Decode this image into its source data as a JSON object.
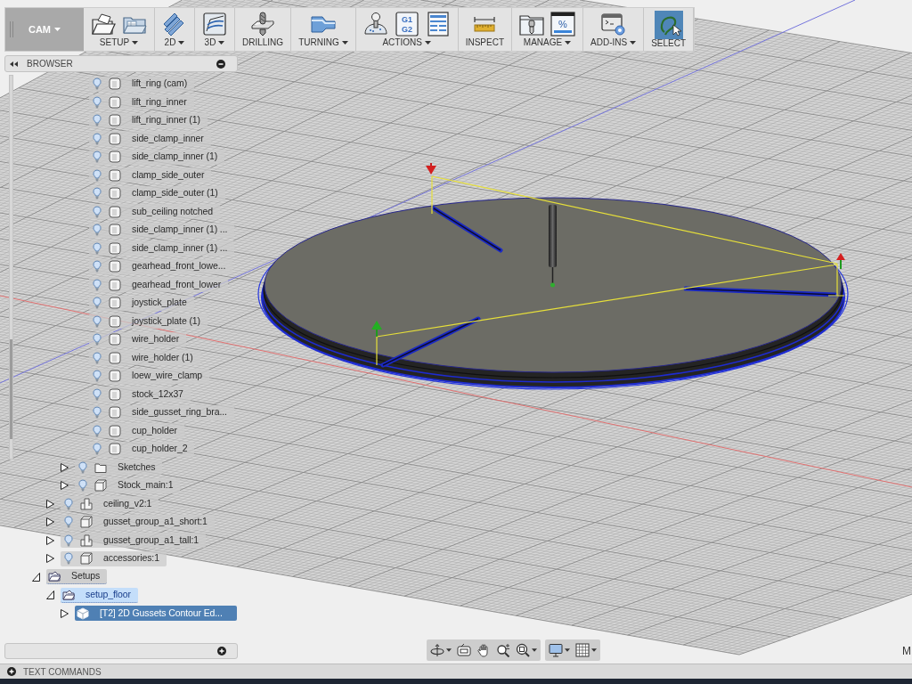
{
  "toolbar": {
    "workspace": {
      "label": "CAM",
      "dropdown": true
    },
    "groups": [
      {
        "label": "SETUP",
        "dropdown": true,
        "selected": false,
        "icons": [
          {
            "kind": "new_setup"
          },
          {
            "kind": "folder"
          }
        ]
      },
      {
        "label": "2D",
        "dropdown": true,
        "selected": false,
        "icons": [
          {
            "kind": "layers"
          }
        ]
      },
      {
        "label": "3D",
        "dropdown": true,
        "selected": false,
        "icons": [
          {
            "kind": "surface"
          }
        ]
      },
      {
        "label": "DRILLING",
        "dropdown": false,
        "selected": false,
        "icons": [
          {
            "kind": "drill"
          }
        ]
      },
      {
        "label": "TURNING",
        "dropdown": true,
        "selected": false,
        "icons": [
          {
            "kind": "lathe"
          }
        ]
      },
      {
        "label": "ACTIONS",
        "dropdown": true,
        "selected": false,
        "icons": [
          {
            "kind": "joystick"
          },
          {
            "kind": "code",
            "text": [
              "G1",
              "G2"
            ]
          },
          {
            "kind": "sheet"
          }
        ]
      },
      {
        "label": "INSPECT",
        "dropdown": false,
        "selected": false,
        "icons": [
          {
            "kind": "ruler"
          }
        ]
      },
      {
        "label": "MANAGE",
        "dropdown": true,
        "selected": false,
        "icons": [
          {
            "kind": "tool_folder"
          },
          {
            "kind": "window",
            "text": [
              "%"
            ]
          }
        ]
      },
      {
        "label": "ADD-INS",
        "dropdown": true,
        "selected": false,
        "icons": [
          {
            "kind": "terminal"
          }
        ]
      },
      {
        "label": "SELECT",
        "dropdown": false,
        "selected": true,
        "icons": [
          {
            "kind": "lasso"
          }
        ]
      }
    ]
  },
  "browser": {
    "title": "BROWSER",
    "tree": [
      {
        "children": [
          {
            "children": [
              {
                "children": [
                  {
                    "label": "lift_ring (cam)",
                    "kind": "body",
                    "visible": true,
                    "selected": false
                  },
                  {
                    "label": "lift_ring_inner",
                    "kind": "body",
                    "visible": true,
                    "selected": false
                  },
                  {
                    "label": "lift_ring_inner (1)",
                    "kind": "body",
                    "visible": true,
                    "selected": false
                  },
                  {
                    "label": "side_clamp_inner",
                    "kind": "body",
                    "visible": true,
                    "selected": false
                  },
                  {
                    "label": "side_clamp_inner (1)",
                    "kind": "body",
                    "visible": true,
                    "selected": false
                  },
                  {
                    "label": "clamp_side_outer",
                    "kind": "body",
                    "visible": true,
                    "selected": false
                  },
                  {
                    "label": "clamp_side_outer (1)",
                    "kind": "body",
                    "visible": true,
                    "selected": false
                  },
                  {
                    "label": "sub_ceiling notched",
                    "kind": "body",
                    "visible": true,
                    "selected": false
                  },
                  {
                    "label": "side_clamp_inner (1) ...",
                    "kind": "body",
                    "visible": true,
                    "selected": false
                  },
                  {
                    "label": "side_clamp_inner (1) ...",
                    "kind": "body",
                    "visible": true,
                    "selected": false
                  },
                  {
                    "label": "gearhead_front_lowe...",
                    "kind": "body",
                    "visible": true,
                    "selected": false
                  },
                  {
                    "label": "gearhead_front_lower",
                    "kind": "body",
                    "visible": true,
                    "selected": false
                  },
                  {
                    "label": "joystick_plate",
                    "kind": "body",
                    "visible": true,
                    "selected": false
                  },
                  {
                    "label": "joystick_plate (1)",
                    "kind": "body",
                    "visible": true,
                    "selected": false
                  },
                  {
                    "label": "wire_holder",
                    "kind": "body",
                    "visible": true,
                    "selected": false
                  },
                  {
                    "label": "wire_holder (1)",
                    "kind": "body",
                    "visible": true,
                    "selected": false
                  },
                  {
                    "label": "loew_wire_clamp",
                    "kind": "body",
                    "visible": true,
                    "selected": false
                  },
                  {
                    "label": "stock_12x37",
                    "kind": "body",
                    "visible": true,
                    "selected": false
                  },
                  {
                    "label": "side_gusset_ring_bra...",
                    "kind": "body",
                    "visible": true,
                    "selected": false
                  },
                  {
                    "label": "cup_holder",
                    "kind": "body",
                    "visible": true,
                    "selected": false
                  },
                  {
                    "label": "cup_holder_2",
                    "kind": "body",
                    "visible": true,
                    "selected": false
                  }
                ]
              },
              {
                "label": "Sketches",
                "kind": "folder",
                "expanded": false,
                "visible": true,
                "selected": false
              },
              {
                "label": "Stock_main:1",
                "kind": "component",
                "expanded": false,
                "visible": true,
                "selected": false
              }
            ]
          },
          {
            "label": "ceiling_v2:1",
            "kind": "linked",
            "expanded": false,
            "visible": true,
            "selected": false
          },
          {
            "label": "gusset_group_a1_short:1",
            "kind": "component",
            "expanded": false,
            "visible": true,
            "selected": false
          },
          {
            "label": "gusset_group_a1_tall:1",
            "kind": "linked",
            "expanded": false,
            "visible": true,
            "selected": false
          },
          {
            "label": "accessories:1",
            "kind": "component",
            "expanded": false,
            "visible": true,
            "selected": false
          }
        ]
      },
      {
        "label": "Setups",
        "kind": "setups",
        "expanded": true,
        "selected": false,
        "active": false,
        "children": [
          {
            "label": "setup_floor",
            "kind": "setup",
            "expanded": true,
            "selected": false,
            "active": true,
            "children": [
              {
                "label": "[T2] 2D Gussets Contour Ed...",
                "kind": "operation",
                "expanded": false,
                "selected": true
              }
            ]
          }
        ]
      }
    ]
  },
  "navigation_bar": {
    "groups": [
      {
        "tools": [
          {
            "kind": "orbit",
            "dropdown": true
          },
          {
            "kind": "look_at",
            "dropdown": false
          },
          {
            "kind": "pan",
            "dropdown": false
          },
          {
            "kind": "zoom",
            "dropdown": false
          },
          {
            "kind": "fit",
            "dropdown": true
          }
        ]
      },
      {
        "tools": [
          {
            "kind": "display",
            "dropdown": true
          },
          {
            "kind": "grid",
            "dropdown": true
          }
        ]
      }
    ]
  },
  "text_commands": {
    "label": "TEXT COMMANDS"
  },
  "viewport": {
    "corner_text": "M"
  }
}
